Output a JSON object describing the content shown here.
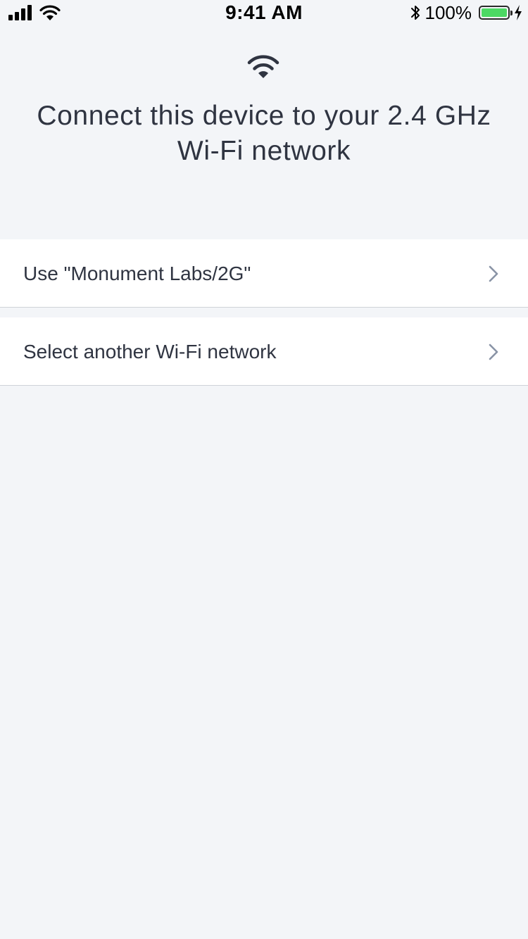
{
  "status_bar": {
    "time": "9:41 AM",
    "battery_percent_label": "100%",
    "battery_level": 1.0,
    "battery_color": "#4cd964",
    "icons": [
      "cellular-signal-icon",
      "wifi-icon",
      "bluetooth-icon",
      "battery-icon",
      "charging-bolt-icon"
    ]
  },
  "header": {
    "icon": "wifi-icon",
    "title": "Connect this device to your 2.4 GHz Wi-Fi network"
  },
  "options": [
    {
      "label": "Use \"Monument Labs/2G\"",
      "icon": "chevron-right-icon"
    },
    {
      "label": "Select another Wi-Fi network",
      "icon": "chevron-right-icon"
    }
  ],
  "colors": {
    "background": "#f3f5f8",
    "text": "#2f3441",
    "chevron": "#8a94a6",
    "divider": "#cfd3d8"
  }
}
